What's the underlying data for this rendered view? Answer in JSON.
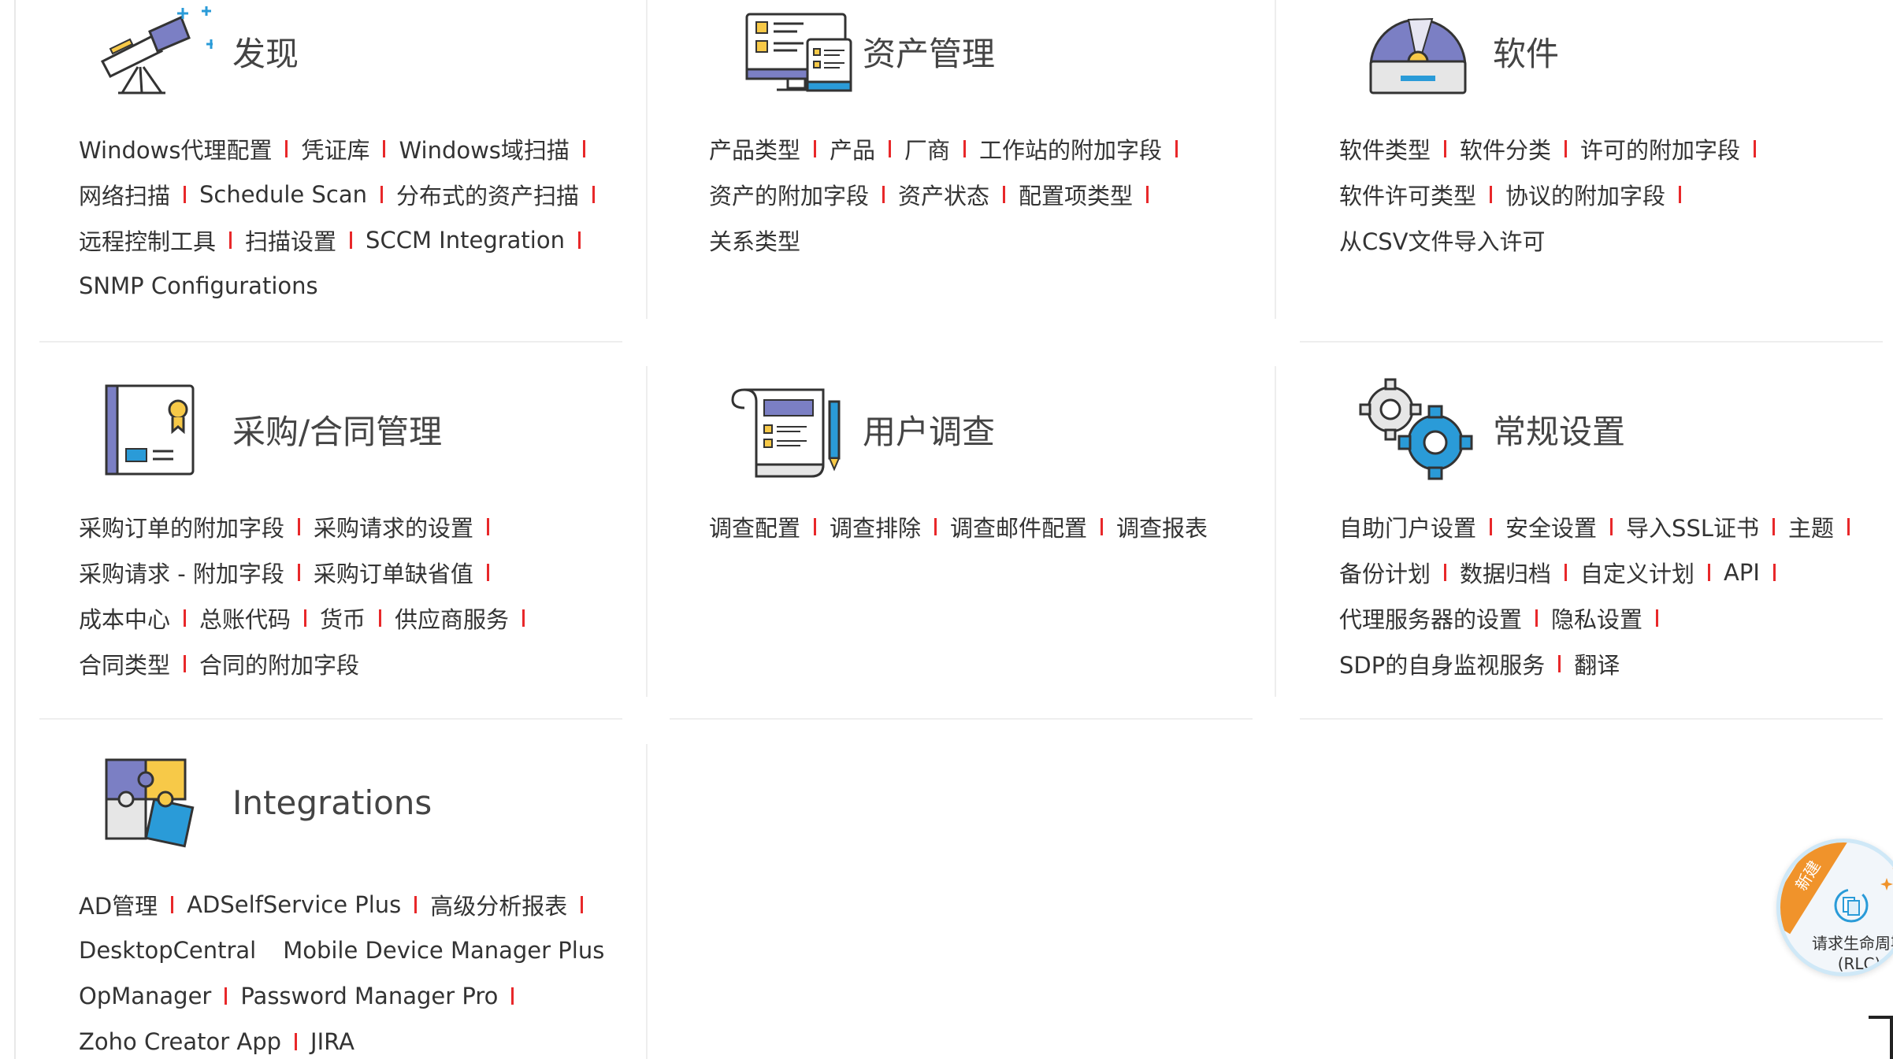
{
  "panels": [
    {
      "id": "discovery",
      "title": "发现",
      "icon": "telescope-icon",
      "rows": [
        [
          "Windows代理配置",
          "凭证库",
          "Windows域扫描"
        ],
        [
          "网络扫描",
          "Schedule Scan",
          "分布式的资产扫描"
        ],
        [
          "远程控制工具",
          "扫描设置",
          "SCCM Integration"
        ],
        [
          "SNMP Configurations"
        ]
      ]
    },
    {
      "id": "asset",
      "title": "资产管理",
      "icon": "computer-devices-icon",
      "rows": [
        [
          "产品类型",
          "产品",
          "厂商",
          "工作站的附加字段"
        ],
        [
          "资产的附加字段",
          "资产状态",
          "配置项类型"
        ],
        [
          "关系类型"
        ]
      ]
    },
    {
      "id": "software",
      "title": "软件",
      "icon": "software-disc-icon",
      "rows": [
        [
          "软件类型",
          "软件分类",
          "许可的附加字段"
        ],
        [
          "软件许可类型",
          "协议的附加字段"
        ],
        [
          "从CSV文件导入许可"
        ]
      ]
    },
    {
      "id": "purchase",
      "title": "采购/合同管理",
      "icon": "contract-certificate-icon",
      "rows": [
        [
          "采购订单的附加字段",
          "采购请求的设置"
        ],
        [
          "采购请求 - 附加字段",
          "采购订单缺省值"
        ],
        [
          "成本中心",
          "总账代码",
          "货币",
          "供应商服务"
        ],
        [
          "合同类型",
          "合同的附加字段"
        ]
      ]
    },
    {
      "id": "survey",
      "title": "用户调查",
      "icon": "survey-scroll-icon",
      "rows": [
        [
          "调查配置",
          "调查排除",
          "调查邮件配置",
          "调查报表"
        ]
      ]
    },
    {
      "id": "general",
      "title": "常规设置",
      "icon": "gears-icon",
      "rows": [
        [
          "自助门户设置",
          "安全设置",
          "导入SSL证书",
          "主题"
        ],
        [
          "备份计划",
          "数据归档",
          "自定义计划",
          "API"
        ],
        [
          "代理服务器的设置",
          "隐私设置"
        ],
        [
          "SDP的自身监视服务",
          "翻译"
        ]
      ]
    },
    {
      "id": "integrations",
      "title": "Integrations",
      "icon": "puzzle-icon",
      "rows": [
        [
          "AD管理",
          "ADSelfService Plus",
          "高级分析报表"
        ],
        [
          "DesktopCentral",
          "Mobile Device Manager Plus"
        ],
        [
          "OpManager",
          "Password Manager Pro"
        ],
        [
          "Zoho Creator App",
          "JIRA"
        ]
      ]
    }
  ],
  "rlc": {
    "ribbon": "新建",
    "line1": "请求生命周期",
    "line2": "(RLC)"
  },
  "colors": {
    "separator": "#e8282a",
    "accent_purple": "#7b7fc4",
    "accent_yellow": "#f7c948",
    "accent_blue": "#2a9bd8"
  }
}
